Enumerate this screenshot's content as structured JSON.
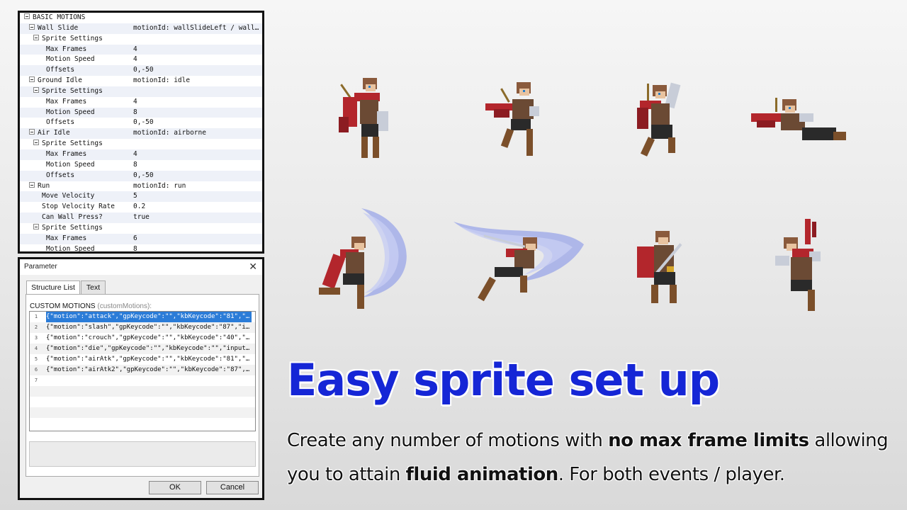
{
  "tree": {
    "rows": [
      {
        "name": "BASIC MOTIONS",
        "value": "",
        "indent": 1,
        "expander": true
      },
      {
        "name": "Wall Slide",
        "value": "motionId: wallSlideLeft / wallSl…",
        "indent": 2,
        "expander": true
      },
      {
        "name": "Sprite Settings",
        "value": "",
        "indent": 3,
        "expander": true
      },
      {
        "name": "Max Frames",
        "value": "4",
        "indent": 4,
        "expander": false
      },
      {
        "name": "Motion Speed",
        "value": "4",
        "indent": 4,
        "expander": false
      },
      {
        "name": "Offsets",
        "value": "0,-50",
        "indent": 4,
        "expander": false
      },
      {
        "name": "Ground Idle",
        "value": "motionId: idle",
        "indent": 2,
        "expander": true
      },
      {
        "name": "Sprite Settings",
        "value": "",
        "indent": 3,
        "expander": true
      },
      {
        "name": "Max Frames",
        "value": "4",
        "indent": 4,
        "expander": false
      },
      {
        "name": "Motion Speed",
        "value": "8",
        "indent": 4,
        "expander": false
      },
      {
        "name": "Offsets",
        "value": "0,-50",
        "indent": 4,
        "expander": false
      },
      {
        "name": "Air Idle",
        "value": "motionId: airborne",
        "indent": 2,
        "expander": true
      },
      {
        "name": "Sprite Settings",
        "value": "",
        "indent": 3,
        "expander": true
      },
      {
        "name": "Max Frames",
        "value": "4",
        "indent": 4,
        "expander": false
      },
      {
        "name": "Motion Speed",
        "value": "8",
        "indent": 4,
        "expander": false
      },
      {
        "name": "Offsets",
        "value": "0,-50",
        "indent": 4,
        "expander": false
      },
      {
        "name": "Run",
        "value": "motionId: run",
        "indent": 2,
        "expander": true
      },
      {
        "name": "Move Velocity",
        "value": "5",
        "indent": 3,
        "expander": false
      },
      {
        "name": "Stop Velocity Rate",
        "value": "0.2",
        "indent": 3,
        "expander": false
      },
      {
        "name": "Can Wall Press?",
        "value": "true",
        "indent": 3,
        "expander": false
      },
      {
        "name": "Sprite Settings",
        "value": "",
        "indent": 3,
        "expander": true
      },
      {
        "name": "Max Frames",
        "value": "6",
        "indent": 4,
        "expander": false
      },
      {
        "name": "Motion Speed",
        "value": "8",
        "indent": 4,
        "expander": false
      }
    ]
  },
  "dialog": {
    "title": "Parameter",
    "close_glyph": "✕",
    "tabs": [
      {
        "label": "Structure List",
        "active": true
      },
      {
        "label": "Text",
        "active": false
      }
    ],
    "list_label": "CUSTOM MOTIONS",
    "list_label_sub": "(customMotions):",
    "lines": [
      {
        "n": "1",
        "text": "{\"motion\":\"attack\",\"gpKeycode\":\"\",\"kbKeycode\":\"81\",\"…"
      },
      {
        "n": "2",
        "text": "{\"motion\":\"slash\",\"gpKeycode\":\"\",\"kbKeycode\":\"87\",\"i…"
      },
      {
        "n": "3",
        "text": "{\"motion\":\"crouch\",\"gpKeycode\":\"\",\"kbKeycode\":\"40\",\"…"
      },
      {
        "n": "4",
        "text": "{\"motion\":\"die\",\"gpKeycode\":\"\",\"kbKeycode\":\"\",\"input…"
      },
      {
        "n": "5",
        "text": "{\"motion\":\"airAtk\",\"gpKeycode\":\"\",\"kbKeycode\":\"81\",\"…"
      },
      {
        "n": "6",
        "text": "{\"motion\":\"airAtk2\",\"gpKeycode\":\"\",\"kbKeycode\":\"87\",…"
      },
      {
        "n": "7",
        "text": ""
      },
      {
        "n": "",
        "text": ""
      },
      {
        "n": "",
        "text": ""
      },
      {
        "n": "",
        "text": ""
      },
      {
        "n": "",
        "text": ""
      }
    ],
    "selected_line": 0,
    "ok_label": "OK",
    "cancel_label": "Cancel"
  },
  "promo": {
    "headline": "Easy sprite set up",
    "line1_a": "Create any number of motions with ",
    "line1_b": "no max frame limits",
    "line1_c": " allowing",
    "line2_a": "you to attain ",
    "line2_b": "fluid animation",
    "line2_c": ". For both events / player."
  },
  "colors": {
    "headline": "#1526d6",
    "selection": "#2b7cd8",
    "scarf": "#b3262c",
    "hair": "#8a5a3c",
    "slash": "#9aa6e8"
  },
  "sprites": [
    {
      "name": "sprite-idle",
      "pose": "stand"
    },
    {
      "name": "sprite-run",
      "pose": "run"
    },
    {
      "name": "sprite-jump",
      "pose": "jump"
    },
    {
      "name": "sprite-crouch",
      "pose": "crouch"
    },
    {
      "name": "sprite-attack-arc",
      "pose": "arc"
    },
    {
      "name": "sprite-slash-dash",
      "pose": "dash"
    },
    {
      "name": "sprite-sword-ready",
      "pose": "ready"
    },
    {
      "name": "sprite-die",
      "pose": "hurt"
    }
  ]
}
